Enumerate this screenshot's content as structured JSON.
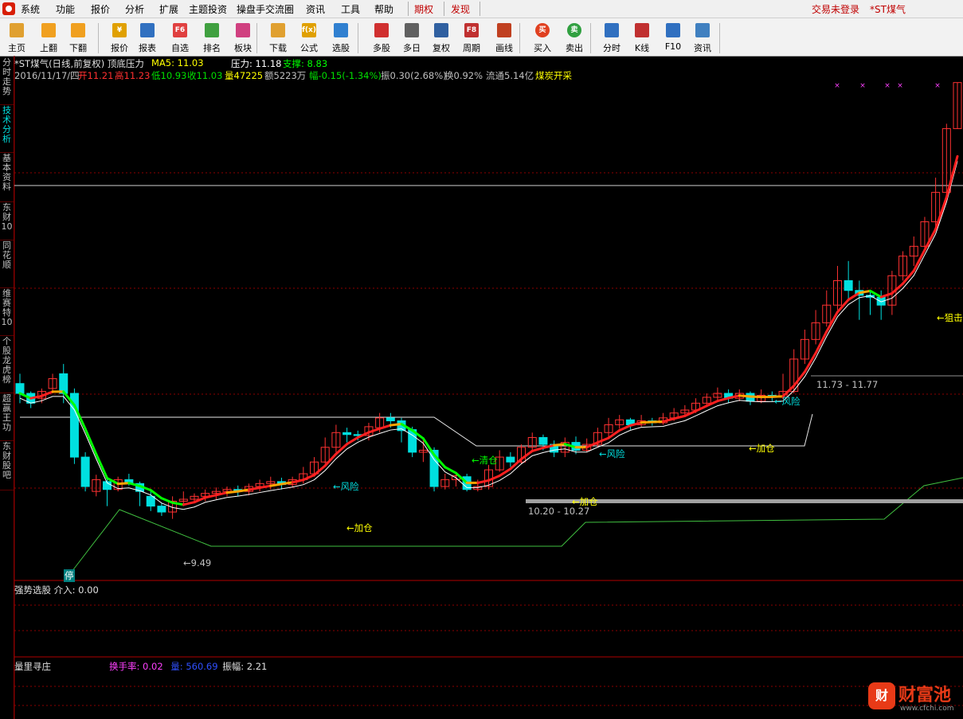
{
  "menu": {
    "items": [
      "系统",
      "功能",
      "报价",
      "分析",
      "扩展",
      "主题投资",
      "操盘手交流圈",
      "资讯",
      "工具",
      "帮助"
    ],
    "special": [
      "期权",
      "发现"
    ],
    "login_status": "交易未登录",
    "stock_tag": "*ST煤气"
  },
  "toolbar": {
    "buttons": [
      {
        "label": "主页",
        "icon": "home-icon"
      },
      {
        "label": "上翻",
        "icon": "arrow-up-icon"
      },
      {
        "label": "下翻",
        "icon": "arrow-down-icon"
      },
      {
        "label": "报价",
        "icon": "yen-icon"
      },
      {
        "label": "报表",
        "icon": "report-icon"
      },
      {
        "label": "自选",
        "icon": "f6-icon"
      },
      {
        "label": "排名",
        "icon": "ranking-icon"
      },
      {
        "label": "板块",
        "icon": "sector-icon"
      },
      {
        "label": "下载",
        "icon": "download-icon"
      },
      {
        "label": "公式",
        "icon": "formula-icon"
      },
      {
        "label": "选股",
        "icon": "stock-pick-icon"
      },
      {
        "label": "多股",
        "icon": "multi-stock-icon"
      },
      {
        "label": "多日",
        "icon": "multi-day-icon"
      },
      {
        "label": "复权",
        "icon": "adjust-icon"
      },
      {
        "label": "周期",
        "icon": "f8-icon"
      },
      {
        "label": "画线",
        "icon": "draw-line-icon"
      },
      {
        "label": "买入",
        "icon": "buy-icon"
      },
      {
        "label": "卖出",
        "icon": "sell-icon"
      },
      {
        "label": "分时",
        "icon": "intraday-icon"
      },
      {
        "label": "K线",
        "icon": "kline-icon"
      },
      {
        "label": "F10",
        "icon": "f10-icon"
      },
      {
        "label": "资讯",
        "icon": "news-icon"
      }
    ],
    "icon_glyphs": {
      "f6-icon": "F6",
      "f8-icon": "F8",
      "yen-icon": "¥",
      "formula-icon": "f(x)",
      "buy-icon": "买",
      "sell-icon": "卖"
    }
  },
  "sidebar": {
    "tabs": [
      "分时走势",
      "技术分析",
      "基本资料",
      "东财10",
      "同花顺",
      "维赛特10",
      "个股龙虎榜",
      "超赢王功",
      "东财股吧"
    ],
    "active": "技术分析"
  },
  "chart_header": {
    "line1": [
      {
        "text": "*ST煤气(日线,前复权) 顶底压力",
        "color": "#e0e0e0"
      },
      {
        "text": "MA5: 11.03",
        "color": "#ffff00"
      },
      {
        "text": "压力: 11.18",
        "color": "#ffffff"
      },
      {
        "text": "支撑: 8.83",
        "color": "#00ff00"
      }
    ],
    "line2": [
      {
        "text": "2016/11/17/四",
        "color": "#c0c0c0"
      },
      {
        "text": "开11.21",
        "color": "#ff3030"
      },
      {
        "text": "高11.23",
        "color": "#ff3030"
      },
      {
        "text": "低10.93",
        "color": "#00e000"
      },
      {
        "text": "收11.03",
        "color": "#00e000"
      },
      {
        "text": "量47225",
        "color": "#ffff00"
      },
      {
        "text": "额5223万",
        "color": "#c0c0c0"
      },
      {
        "text": "幅-0.15(-1.34%)",
        "color": "#00e000"
      },
      {
        "text": "振0.30(2.68%)",
        "color": "#c0c0c0"
      },
      {
        "text": "换0.92%",
        "color": "#c0c0c0"
      },
      {
        "text": "流通5.14亿",
        "color": "#c0c0c0"
      },
      {
        "text": "煤炭开采",
        "color": "#ffff00"
      }
    ]
  },
  "annotations": [
    {
      "text": "←9.49",
      "color": "#c0c0c0"
    },
    {
      "text": "停",
      "color": "#00e0e0"
    },
    {
      "text": "←风险",
      "color": "#00e0e0"
    },
    {
      "text": "←加仓",
      "color": "#ffff00"
    },
    {
      "text": "←清仓",
      "color": "#00ff00"
    },
    {
      "text": "10.20 - 10.27",
      "color": "#c0c0c0"
    },
    {
      "text": "←加仓",
      "color": "#ffff00"
    },
    {
      "text": "←风险",
      "color": "#00e0e0"
    },
    {
      "text": "←加仓",
      "color": "#ffff00"
    },
    {
      "text": "←风险",
      "color": "#00e0e0"
    },
    {
      "text": "11.73 - 11.77",
      "color": "#c0c0c0"
    },
    {
      "text": "←狙击",
      "color": "#ffff00"
    }
  ],
  "panels": {
    "indicator1": {
      "name": "强势选股",
      "value": "介入: 0.00"
    },
    "indicator2": {
      "name": "量里寻庄",
      "turnover": "换手率: 0.02",
      "volume": "量: 560.69",
      "amplitude": "振幅: 2.21"
    }
  },
  "watermark": {
    "icon": "财",
    "name": "财富池",
    "url": "www.cfchi.com"
  },
  "colors": {
    "up": "#ff3232",
    "down": "#00e0e0",
    "grid": "#8b0000",
    "ma_green": "#00ff00",
    "ma_red": "#ff2020",
    "ma_orange": "#ffa500"
  },
  "chart_data": {
    "type": "candlestick",
    "y_range": [
      8.8,
      13.9
    ],
    "price_levels": {
      "resistance_label": 11.18,
      "support_label": 8.83,
      "low_marker": 9.49,
      "band_1": [
        10.2,
        10.27
      ],
      "band_2": [
        11.73,
        11.77
      ]
    },
    "candles": [
      [
        10.8,
        10.7,
        10.9,
        10.6
      ],
      [
        10.7,
        10.6,
        10.72,
        10.55
      ],
      [
        10.65,
        10.72,
        10.75,
        10.6
      ],
      [
        10.75,
        10.85,
        10.9,
        10.7
      ],
      [
        10.9,
        10.7,
        11.0,
        10.6
      ],
      [
        10.7,
        10.05,
        10.75,
        9.98
      ],
      [
        10.05,
        9.75,
        10.1,
        9.7
      ],
      [
        9.7,
        9.82,
        9.87,
        9.65
      ],
      [
        9.8,
        9.72,
        9.85,
        9.55
      ],
      [
        9.72,
        9.82,
        9.85,
        9.7
      ],
      [
        9.82,
        9.78,
        9.88,
        9.76
      ],
      [
        9.78,
        9.7,
        9.8,
        9.55
      ],
      [
        9.65,
        9.55,
        9.7,
        9.5
      ],
      [
        9.55,
        9.49,
        9.58,
        9.45
      ],
      [
        9.49,
        9.6,
        9.65,
        9.42
      ],
      [
        9.6,
        9.62,
        9.7,
        9.55
      ],
      [
        9.62,
        9.65,
        9.68,
        9.58
      ],
      [
        9.65,
        9.68,
        9.72,
        9.6
      ],
      [
        9.68,
        9.7,
        9.74,
        9.62
      ],
      [
        9.7,
        9.72,
        9.75,
        9.65
      ],
      [
        9.72,
        9.7,
        9.76,
        9.65
      ],
      [
        9.7,
        9.75,
        9.78,
        9.66
      ],
      [
        9.75,
        9.78,
        9.82,
        9.7
      ],
      [
        9.78,
        9.8,
        9.85,
        9.72
      ],
      [
        9.8,
        9.77,
        9.84,
        9.72
      ],
      [
        9.77,
        9.82,
        9.85,
        9.74
      ],
      [
        9.82,
        9.88,
        9.95,
        9.78
      ],
      [
        9.88,
        10.0,
        10.05,
        9.85
      ],
      [
        10.0,
        10.15,
        10.25,
        9.98
      ],
      [
        10.15,
        10.3,
        10.38,
        10.1
      ],
      [
        10.3,
        10.28,
        10.35,
        10.2
      ],
      [
        10.28,
        10.27,
        10.32,
        10.22
      ],
      [
        10.27,
        10.36,
        10.4,
        10.22
      ],
      [
        10.35,
        10.45,
        10.5,
        10.3
      ],
      [
        10.45,
        10.42,
        10.5,
        10.35
      ],
      [
        10.42,
        10.32,
        10.45,
        10.2
      ],
      [
        10.33,
        10.1,
        10.36,
        10.05
      ],
      [
        10.1,
        10.12,
        10.25,
        10.0
      ],
      [
        10.12,
        9.75,
        10.15,
        9.7
      ],
      [
        9.75,
        9.82,
        9.88,
        9.72
      ],
      [
        9.82,
        9.86,
        9.9,
        9.75
      ],
      [
        9.85,
        9.72,
        9.88,
        9.7
      ],
      [
        9.72,
        9.75,
        9.82,
        9.7
      ],
      [
        9.75,
        9.92,
        9.97,
        9.72
      ],
      [
        9.92,
        10.05,
        10.12,
        9.9
      ],
      [
        10.05,
        10.0,
        10.1,
        9.95
      ],
      [
        10.0,
        10.15,
        10.18,
        9.98
      ],
      [
        10.15,
        10.25,
        10.3,
        10.1
      ],
      [
        10.25,
        10.18,
        10.28,
        10.12
      ],
      [
        10.18,
        10.1,
        10.22,
        10.05
      ],
      [
        10.1,
        10.2,
        10.25,
        10.05
      ],
      [
        10.2,
        10.12,
        10.26,
        10.08
      ],
      [
        10.12,
        10.18,
        10.24,
        10.1
      ],
      [
        10.18,
        10.3,
        10.35,
        10.15
      ],
      [
        10.3,
        10.38,
        10.45,
        10.25
      ],
      [
        10.38,
        10.43,
        10.48,
        10.34
      ],
      [
        10.43,
        10.38,
        10.45,
        10.33
      ],
      [
        10.38,
        10.42,
        10.48,
        10.36
      ],
      [
        10.42,
        10.4,
        10.45,
        10.37
      ],
      [
        10.4,
        10.45,
        10.5,
        10.38
      ],
      [
        10.45,
        10.5,
        10.55,
        10.42
      ],
      [
        10.5,
        10.53,
        10.58,
        10.47
      ],
      [
        10.53,
        10.6,
        10.65,
        10.5
      ],
      [
        10.6,
        10.66,
        10.7,
        10.56
      ],
      [
        10.66,
        10.7,
        10.76,
        10.62
      ],
      [
        10.7,
        10.65,
        10.74,
        10.6
      ],
      [
        10.65,
        10.7,
        10.74,
        10.62
      ],
      [
        10.7,
        10.62,
        10.72,
        10.58
      ],
      [
        10.62,
        10.68,
        10.74,
        10.6
      ],
      [
        10.68,
        10.66,
        10.72,
        10.62
      ],
      [
        10.66,
        10.72,
        10.9,
        10.64
      ],
      [
        10.72,
        11.05,
        11.15,
        10.7
      ],
      [
        11.05,
        11.25,
        11.35,
        11.0
      ],
      [
        11.25,
        11.42,
        11.55,
        11.2
      ],
      [
        11.42,
        11.6,
        11.75,
        11.38
      ],
      [
        11.6,
        11.85,
        12.0,
        11.55
      ],
      [
        11.85,
        11.75,
        12.05,
        11.65
      ],
      [
        11.75,
        11.7,
        11.85,
        11.45
      ],
      [
        11.7,
        11.68,
        11.75,
        11.5
      ],
      [
        11.68,
        11.6,
        11.75,
        11.45
      ],
      [
        11.6,
        11.9,
        11.95,
        11.5
      ],
      [
        11.9,
        12.1,
        12.15,
        11.85
      ],
      [
        12.1,
        12.2,
        12.3,
        12.0
      ],
      [
        12.2,
        12.45,
        12.5,
        12.15
      ],
      [
        12.45,
        12.75,
        12.9,
        12.4
      ],
      [
        12.75,
        13.4,
        13.45,
        12.7
      ],
      [
        13.4,
        13.87,
        13.87,
        13.4
      ]
    ]
  }
}
